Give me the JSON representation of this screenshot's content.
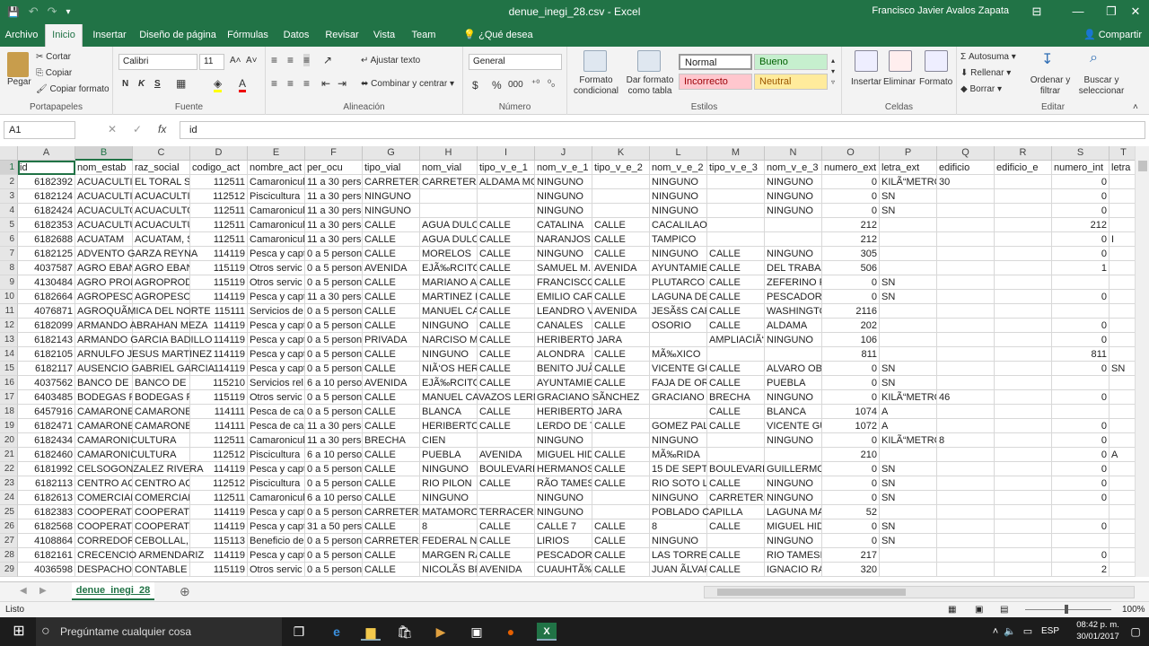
{
  "window": {
    "title": "denue_inegi_28.csv  -  Excel",
    "user": "Francisco Javier Avalos Zapata",
    "minimize": "—",
    "maximize": "❐",
    "close": "✕",
    "ribbon_toggle": "⊟"
  },
  "qat": {
    "save": "💾",
    "undo": "↶",
    "redo": "↷",
    "customize": "▾"
  },
  "tabs": [
    "Archivo",
    "Inicio",
    "Insertar",
    "Diseño de página",
    "Fórmulas",
    "Datos",
    "Revisar",
    "Vista",
    "Team",
    "¿Qué desea hacer?"
  ],
  "share": "Compartir",
  "ribbon": {
    "portapapeles": {
      "label": "Portapapeles",
      "pegar": "Pegar",
      "cortar": "Cortar",
      "copiar": "Copiar",
      "copiar_formato": "Copiar formato"
    },
    "fuente": {
      "label": "Fuente",
      "font": "Calibri",
      "size": "11",
      "bold": "N",
      "italic": "K",
      "underline": "S"
    },
    "alineacion": {
      "label": "Alineación",
      "ajustar": "Ajustar texto",
      "combinar": "Combinar y centrar"
    },
    "numero": {
      "label": "Número",
      "format": "General",
      "currency": "$",
      "percent": "%",
      "thousands": "000"
    },
    "estilos": {
      "label": "Estilos",
      "formato_condicional": "Formato condicional",
      "dar_formato": "Dar formato como tabla",
      "normal": "Normal",
      "bueno": "Bueno",
      "incorrecto": "Incorrecto",
      "neutral": "Neutral",
      "colors": {
        "bueno_bg": "#c6efce",
        "bueno_fg": "#006100",
        "incorrecto_bg": "#ffc7ce",
        "incorrecto_fg": "#9c0006",
        "neutral_bg": "#ffeb9c",
        "neutral_fg": "#9c5700"
      }
    },
    "celdas": {
      "label": "Celdas",
      "insertar": "Insertar",
      "eliminar": "Eliminar",
      "formato": "Formato"
    },
    "modificar": {
      "label": "Editar",
      "autosuma": "Autosuma",
      "rellenar": "Rellenar",
      "borrar": "Borrar",
      "ordenar": "Ordenar y filtrar",
      "buscar": "Buscar y seleccionar"
    }
  },
  "formula_bar": {
    "name_box": "A1",
    "cancel": "✕",
    "enter": "✓",
    "fx": "fx",
    "value": "id"
  },
  "grid": {
    "columns": [
      "A",
      "B",
      "C",
      "D",
      "E",
      "F",
      "G",
      "H",
      "I",
      "J",
      "K",
      "L",
      "M",
      "N",
      "O",
      "P",
      "Q",
      "R",
      "S",
      "T"
    ],
    "selected_column": "B",
    "row_numbers": [
      "1",
      "2",
      "3",
      "4",
      "5",
      "6",
      "7",
      "8",
      "9",
      "10",
      "11",
      "12",
      "13",
      "14",
      "15",
      "16",
      "17",
      "18",
      "19",
      "20",
      "21",
      "22",
      "23",
      "24",
      "25",
      "26",
      "27",
      "28",
      "29"
    ],
    "rows": [
      [
        "id",
        "nom_estab",
        "raz_social",
        "codigo_act",
        "nombre_act",
        "per_ocu",
        "tipo_vial",
        "nom_vial",
        "tipo_v_e_1",
        "nom_v_e_1",
        "tipo_v_e_2",
        "nom_v_e_2",
        "tipo_v_e_3",
        "nom_v_e_3",
        "numero_ext",
        "letra_ext",
        "edificio",
        "edificio_e",
        "numero_int",
        "letra"
      ],
      [
        "6182392",
        "ACUACULTIVO",
        "EL TORAL S",
        "112511",
        "Camaronicul",
        "11 a 30 perso",
        "CARRETERA",
        "CARRETERA A",
        "ALDAMA MO",
        "NINGUNO",
        "",
        "NINGUNO",
        "",
        "NINGUNO",
        "0",
        "KILÃ“METRO",
        "30",
        "",
        "0",
        ""
      ],
      [
        "6182124",
        "ACUACULTIVA",
        "ACUACULTIV",
        "112512",
        "Piscicultura",
        "11 a 30 personas",
        "NINGUNO",
        "",
        "",
        "NINGUNO",
        "",
        "NINGUNO",
        "",
        "NINGUNO",
        "0",
        "SN",
        "",
        "",
        "0",
        ""
      ],
      [
        "6182424",
        "ACUACULTOR",
        "ACUACULTOR",
        "112511",
        "Camaronicul",
        "11 a 30 personas",
        "NINGUNO",
        "",
        "",
        "NINGUNO",
        "",
        "NINGUNO",
        "",
        "NINGUNO",
        "0",
        "SN",
        "",
        "",
        "0",
        ""
      ],
      [
        "6182353",
        "ACUACULTUR",
        "ACUACULTUR",
        "112511",
        "Camaronicul",
        "11 a 30 perso",
        "CALLE",
        "AGUA DULCE",
        "CALLE",
        "CATALINA",
        "CALLE",
        "CACALILAO",
        "",
        "",
        "212",
        "",
        "",
        "",
        "212",
        ""
      ],
      [
        "6182688",
        "ACUATAM",
        "ACUATAM, S",
        "112511",
        "Camaronicul",
        "11 a 30 perso",
        "CALLE",
        "AGUA DULCE",
        "CALLE",
        "NARANJOS",
        "CALLE",
        "TAMPICO",
        "",
        "",
        "212",
        "",
        "",
        "",
        "0",
        "I"
      ],
      [
        "6182125",
        "ADVENTO GARZA REYNA",
        "",
        "114119",
        "Pesca y capt",
        "0 a 5 persona",
        "CALLE",
        "MORELOS",
        "CALLE",
        "NINGUNO",
        "CALLE",
        "NINGUNO",
        "CALLE",
        "NINGUNO",
        "305",
        "",
        "",
        "",
        "0",
        ""
      ],
      [
        "4037587",
        "AGRO EBANO",
        "AGRO EBANO",
        "115119",
        "Otros servic",
        "0 a 5 persona",
        "AVENIDA",
        "EJÃ‰RCITO",
        "CALLE",
        "SAMUEL M. L",
        "AVENIDA",
        "AYUNTAMIEN",
        "CALLE",
        "DEL TRABAJO",
        "506",
        "",
        "",
        "",
        "1",
        ""
      ],
      [
        "4130484",
        "AGRO PRODU",
        "AGROPRODU",
        "115119",
        "Otros servic",
        "0 a 5 persona",
        "CALLE",
        "MARIANO AZ",
        "CALLE",
        "FRANCISCO",
        "CALLE",
        "PLUTARCO EL",
        "CALLE",
        "ZEFERINO FA",
        "0",
        "SN",
        "",
        "",
        "",
        ""
      ],
      [
        "6182664",
        "AGROPESCA",
        "AGROPESCA",
        "114119",
        "Pesca y capt",
        "11 a 30 perso",
        "CALLE",
        "MARTINEZ M",
        "CALLE",
        "EMILIO CARR",
        "CALLE",
        "LAGUNA DE C",
        "CALLE",
        "PESCADORES",
        "0",
        "SN",
        "",
        "",
        "0",
        ""
      ],
      [
        "4076871",
        "AGROQUÃMICA DEL NORTE",
        "",
        "115111",
        "Servicios de",
        "0 a 5 persona",
        "CALLE",
        "MANUEL CAS",
        "CALLE",
        "LEANDRO VA",
        "AVENIDA",
        "JESÃšS CARR",
        "CALLE",
        "WASHINGTON",
        "2116",
        "",
        "",
        "",
        "",
        ""
      ],
      [
        "6182099",
        "ARMANDO ABRAHAN MEZA",
        "",
        "114119",
        "Pesca y capt",
        "0 a 5 persona",
        "CALLE",
        "NINGUNO",
        "CALLE",
        "CANALES",
        "CALLE",
        "OSORIO",
        "CALLE",
        "ALDAMA",
        "202",
        "",
        "",
        "",
        "0",
        ""
      ],
      [
        "6182143",
        "ARMANDO GARCIA BADILLO",
        "",
        "114119",
        "Pesca y capt",
        "0 a 5 persona",
        "PRIVADA",
        "NARCISO ME",
        "CALLE",
        "HERIBERTO JARA",
        "",
        "",
        "AMPLIACIÃ“N",
        "NINGUNO",
        "106",
        "",
        "",
        "",
        "0",
        ""
      ],
      [
        "6182105",
        "ARNULFO JESUS MARTINEZ",
        "",
        "114119",
        "Pesca y capt",
        "0 a 5 persona",
        "CALLE",
        "NINGUNO",
        "CALLE",
        "ALONDRA",
        "CALLE",
        "MÃ‰XICO",
        "",
        "",
        "811",
        "",
        "",
        "",
        "811",
        ""
      ],
      [
        "6182117",
        "AUSENCIO GABRIEL GARCIA",
        "",
        "114119",
        "Pesca y capt",
        "0 a 5 persona",
        "CALLE",
        "NIÃ‘OS HERO",
        "CALLE",
        "BENITO JUÃ",
        "CALLE",
        "VICENTE GUE",
        "CALLE",
        "ALVARO OBR",
        "0",
        "SN",
        "",
        "",
        "0",
        "SN"
      ],
      [
        "4037562",
        "BANCO DE SE",
        "BANCO DE SE",
        "115210",
        "Servicios rel",
        "6 a 10 person",
        "AVENIDA",
        "EJÃ‰RCITO",
        "CALLE",
        "AYUNTAMIEN",
        "CALLE",
        "FAJA DE ORO",
        "CALLE",
        "PUEBLA",
        "0",
        "SN",
        "",
        "",
        "",
        ""
      ],
      [
        "6403485",
        "BODEGAS PU",
        "BODEGAS PU",
        "115119",
        "Otros servic",
        "0 a 5 persona",
        "CALLE",
        "MANUEL CAVAZOS LERMA",
        "",
        "GRACIANO SÃNCHEZ",
        "",
        "GRACIANO S",
        "BRECHA",
        "NINGUNO",
        "0",
        "KILÃ“METRO",
        "46",
        "",
        "0",
        ""
      ],
      [
        "6457916",
        "CAMARONERO",
        "CAMARONER",
        "114111",
        "Pesca de can",
        "0 a 5 persona",
        "CALLE",
        "BLANCA",
        "CALLE",
        "HERIBERTO JARA",
        "",
        "",
        "CALLE",
        "BLANCA",
        "1074",
        "A",
        "",
        "",
        "",
        ""
      ],
      [
        "6182471",
        "CAMARONERO",
        "CAMARONER",
        "114111",
        "Pesca de can",
        "11 a 30 perso",
        "CALLE",
        "HERIBERTO J",
        "CALLE",
        "LERDO DE TE",
        "CALLE",
        "GOMEZ PALA",
        "CALLE",
        "VICENTE GUE",
        "1072",
        "A",
        "",
        "",
        "0",
        ""
      ],
      [
        "6182434",
        "CAMARONICULTURA",
        "",
        "112511",
        "Camaronicul",
        "11 a 30 perso",
        "BRECHA",
        "CIEN",
        "",
        "NINGUNO",
        "",
        "NINGUNO",
        "",
        "NINGUNO",
        "0",
        "KILÃ“METRO",
        "8",
        "",
        "0",
        ""
      ],
      [
        "6182460",
        "CAMARONICULTURA",
        "",
        "112512",
        "Piscicultura",
        "6 a 10 person",
        "CALLE",
        "PUEBLA",
        "AVENIDA",
        "MIGUEL HIDA",
        "CALLE",
        "MÃ‰RIDA",
        "",
        "",
        "210",
        "",
        "",
        "",
        "0",
        "A"
      ],
      [
        "6181992",
        "CELSOGONZALEZ RIVERA",
        "",
        "114119",
        "Pesca y capt",
        "0 a 5 persona",
        "CALLE",
        "NINGUNO",
        "BOULEVARD",
        "HERMANOS",
        "CALLE",
        "15 DE SEPTIE",
        "BOULEVARD",
        "GUILLERMO",
        "0",
        "SN",
        "",
        "",
        "0",
        ""
      ],
      [
        "6182113",
        "CENTRO ACU",
        "CENTRO ACU",
        "112512",
        "Piscicultura",
        "0 a 5 persona",
        "CALLE",
        "RIO PILON",
        "CALLE",
        "RÃO TAMESÃ",
        "CALLE",
        "RIO SOTO LA",
        "CALLE",
        "NINGUNO",
        "0",
        "SN",
        "",
        "",
        "0",
        ""
      ],
      [
        "6182613",
        "COMERCIALI",
        "COMERCIALI",
        "112511",
        "Camaronicul",
        "6 a 10 person",
        "CALLE",
        "NINGUNO",
        "",
        "NINGUNO",
        "",
        "NINGUNO",
        "CARRETERA",
        "NINGUNO",
        "0",
        "SN",
        "",
        "",
        "0",
        ""
      ],
      [
        "6182383",
        "COOPERATIV",
        "COOPERATIV",
        "114119",
        "Pesca y capt",
        "0 a 5 persona",
        "CARRETERA",
        "MATAMORO",
        "TERRACERÃA",
        "NINGUNO",
        "",
        "POBLADO CAPILLA",
        "",
        "LAGUNA MA",
        "52",
        "",
        "",
        "",
        "",
        ""
      ],
      [
        "6182568",
        "COOPERATIV",
        "COOPERATIV",
        "114119",
        "Pesca y capt",
        "31 a 50 perso",
        "CALLE",
        "8",
        "CALLE",
        "CALLE 7",
        "CALLE",
        "8",
        "CALLE",
        "MIGUEL HIDA",
        "0",
        "SN",
        "",
        "",
        "0",
        ""
      ],
      [
        "4108864",
        "CORREDORA",
        "CEBOLLAL, S.",
        "115113",
        "Beneficio de",
        "0 a 5 persona",
        "CARRETERA",
        "FEDERAL NÃ",
        "CALLE",
        "LIRIOS",
        "CALLE",
        "NINGUNO",
        "",
        "NINGUNO",
        "0",
        "SN",
        "",
        "",
        "",
        ""
      ],
      [
        "6182161",
        "CRECENCIO ARMENDARIZ",
        "",
        "114119",
        "Pesca y capt",
        "0 a 5 persona",
        "CALLE",
        "MARGEN RÃ",
        "CALLE",
        "PESCADORES",
        "CALLE",
        "LAS TORRES",
        "CALLE",
        "RIO TAMESI",
        "217",
        "",
        "",
        "",
        "0",
        ""
      ],
      [
        "4036598",
        "DESPACHO CONTABLE",
        "",
        "115119",
        "Otros servic",
        "0 a 5 persona",
        "CALLE",
        "NICOLÃS BRA",
        "AVENIDA",
        "CUAUHTÃ‰MO",
        "CALLE",
        "JUAN ÃLVARE",
        "CALLE",
        "IGNACIO RAM",
        "320",
        "",
        "",
        "",
        "2",
        ""
      ]
    ],
    "numeric_columns": [
      0,
      3,
      14,
      18
    ]
  },
  "sheet_tabs": [
    "denue_inegi_28"
  ],
  "add_sheet": "⊕",
  "status": {
    "ready": "Listo",
    "zoom": "100%"
  },
  "taskbar": {
    "search_placeholder": "Pregúntame cualquier cosa",
    "time": "08:42 p. m.",
    "date": "30/01/2017",
    "lang": "ESP"
  }
}
